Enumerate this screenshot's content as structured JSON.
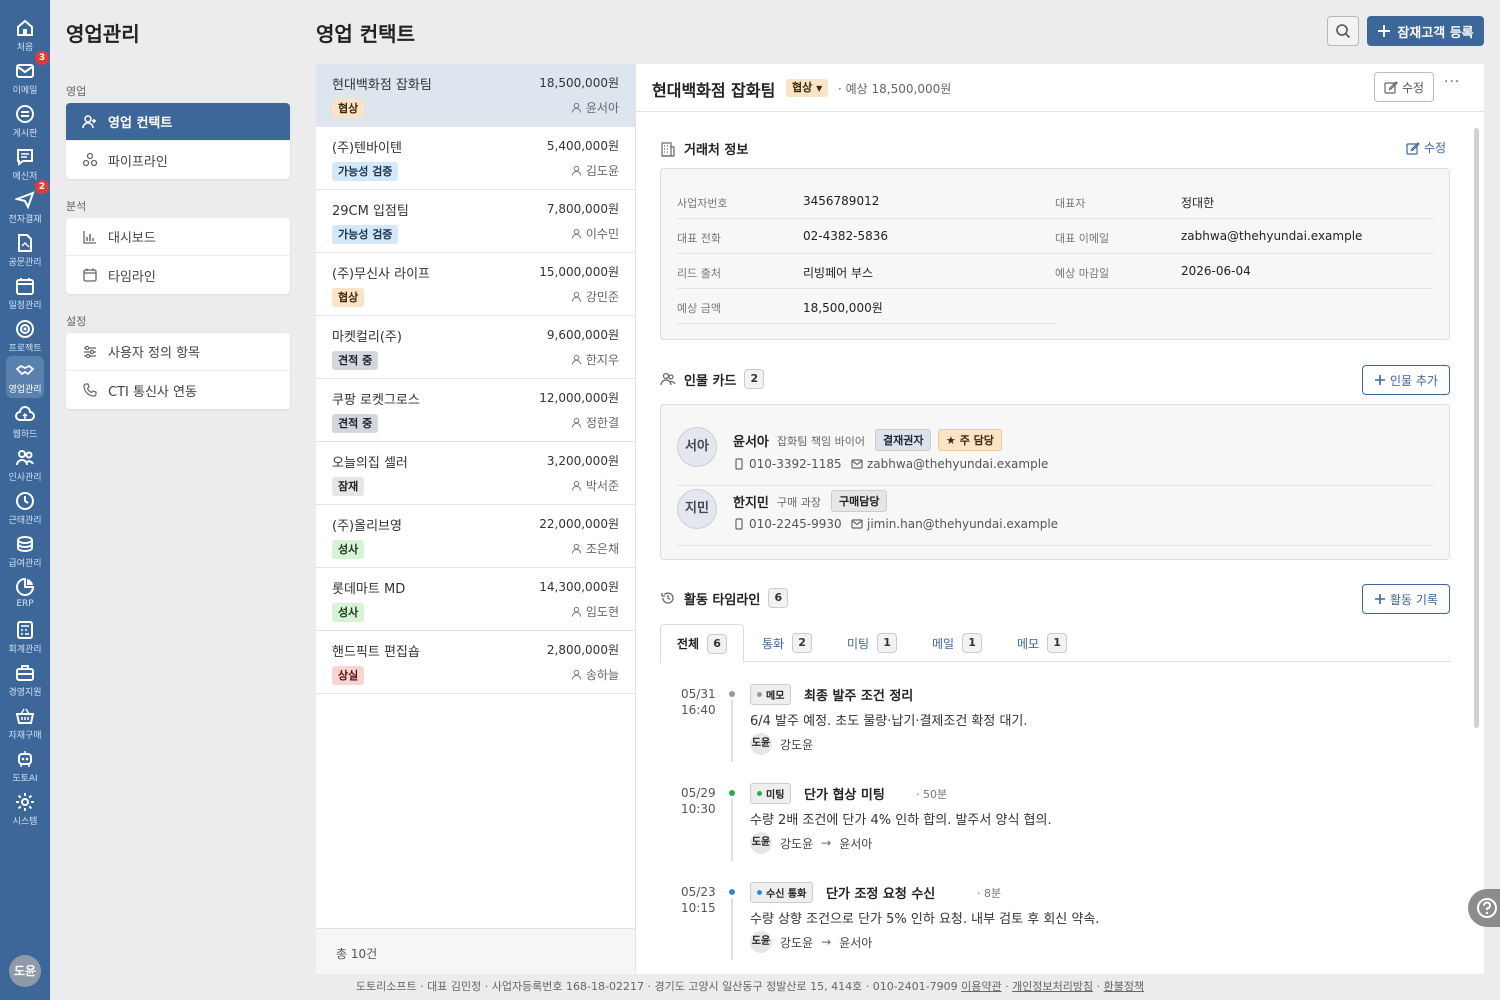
{
  "rail": {
    "items": [
      {
        "label": "처음",
        "icon": "home-icon"
      },
      {
        "label": "이메일",
        "icon": "mail-icon",
        "badge": "3"
      },
      {
        "label": "게시판",
        "icon": "board-icon"
      },
      {
        "label": "메신저",
        "icon": "messenger-icon"
      },
      {
        "label": "전자결재",
        "icon": "approval-icon",
        "badge": "2"
      },
      {
        "label": "공문관리",
        "icon": "document-icon"
      },
      {
        "label": "일정관리",
        "icon": "calendar-icon"
      },
      {
        "label": "프로젝트",
        "icon": "target-icon"
      },
      {
        "label": "영업관리",
        "icon": "handshake-icon",
        "active": true
      },
      {
        "label": "웹하드",
        "icon": "cloud-icon"
      },
      {
        "label": "인사관리",
        "icon": "people-icon"
      },
      {
        "label": "근태관리",
        "icon": "clock-icon"
      },
      {
        "label": "급여관리",
        "icon": "coins-icon"
      },
      {
        "label": "ERP",
        "icon": "pie-chart-icon"
      },
      {
        "label": "회계관리",
        "icon": "calculator-icon"
      },
      {
        "label": "경영지원",
        "icon": "briefcase-icon"
      },
      {
        "label": "자재구매",
        "icon": "basket-icon"
      },
      {
        "label": "도토AI",
        "icon": "robot-icon"
      },
      {
        "label": "시스템",
        "icon": "gear-icon"
      }
    ],
    "user_initials": "도윤"
  },
  "sidebar": {
    "title": "영업관리",
    "groups": [
      {
        "label": "영업",
        "items": [
          "영업 컨택트",
          "파이프라인"
        ]
      },
      {
        "label": "분석",
        "items": [
          "대시보드",
          "타임라인"
        ]
      },
      {
        "label": "설정",
        "items": [
          "사용자 정의 항목",
          "CTI 통신사 연동"
        ]
      }
    ]
  },
  "header": {
    "title": "영업 컨택트",
    "register_label": "잠재고객 등록"
  },
  "list": {
    "items": [
      {
        "name": "현대백화점 잡화팀",
        "amount": "18,500,000원",
        "stage": "협상",
        "owner": "윤서아"
      },
      {
        "name": "(주)텐바이텐",
        "amount": "5,400,000원",
        "stage": "가능성 검증",
        "owner": "김도윤"
      },
      {
        "name": "29CM 입점팀",
        "amount": "7,800,000원",
        "stage": "가능성 검증",
        "owner": "이수민"
      },
      {
        "name": "(주)무신사 라이프",
        "amount": "15,000,000원",
        "stage": "협상",
        "owner": "강민준"
      },
      {
        "name": "마켓컬리(주)",
        "amount": "9,600,000원",
        "stage": "견적 중",
        "owner": "한지우"
      },
      {
        "name": "쿠팡 로켓그로스",
        "amount": "12,000,000원",
        "stage": "견적 중",
        "owner": "정한결"
      },
      {
        "name": "오늘의집 셀러",
        "amount": "3,200,000원",
        "stage": "잠재",
        "owner": "박서준"
      },
      {
        "name": "(주)올리브영",
        "amount": "22,000,000원",
        "stage": "성사",
        "owner": "조은채"
      },
      {
        "name": "롯데마트 MD",
        "amount": "14,300,000원",
        "stage": "성사",
        "owner": "임도현"
      },
      {
        "name": "핸드픽트 편집숍",
        "amount": "2,800,000원",
        "stage": "상실",
        "owner": "송하늘"
      }
    ],
    "total": "총 10건"
  },
  "detail": {
    "title": "현대백화점 잡화팀",
    "stage": "협상",
    "expected": "· 예상 18,500,000원",
    "edit_label": "수정",
    "more": "···",
    "company": {
      "heading": "거래처 정보",
      "edit_label": "수정",
      "fields": {
        "biz_no_label": "사업자번호",
        "biz_no": "3456789012",
        "ceo_label": "대표자",
        "ceo": "정대한",
        "phone_label": "대표 전화",
        "phone": "02-4382-5836",
        "email_label": "대표 이메일",
        "email": "zabhwa@thehyundai.example",
        "source_label": "리드 출처",
        "source": "리빙페어 부스",
        "close_label": "예상 마감일",
        "close": "2026-06-04",
        "amount_label": "예상 금액",
        "amount": "18,500,000원"
      }
    },
    "people": {
      "heading": "인물 카드",
      "count": "2",
      "add_label": "인물 추가",
      "items": [
        {
          "initials": "서아",
          "name": "윤서아",
          "role": "잡화팀 책임 바이어",
          "tag": "결재권자",
          "primary": "주 담당",
          "phone": "010-3392-1185",
          "email": "zabhwa@thehyundai.example"
        },
        {
          "initials": "지민",
          "name": "한지민",
          "role": "구매 과장",
          "tag": "구매담당",
          "phone": "010-2245-9930",
          "email": "jimin.han@thehyundai.example"
        }
      ]
    },
    "timeline": {
      "heading": "활동 타임라인",
      "count": "6",
      "add_label": "활동 기록",
      "tabs": [
        {
          "label": "전체",
          "count": "6"
        },
        {
          "label": "통화",
          "count": "2"
        },
        {
          "label": "미팅",
          "count": "1"
        },
        {
          "label": "메일",
          "count": "1"
        },
        {
          "label": "메모",
          "count": "1"
        }
      ],
      "events": [
        {
          "date": "05/31",
          "time": "16:40",
          "type": "메모",
          "title": "최종 발주 조건 정리",
          "duration": "",
          "body": "6/4 발주 예정. 초도 물량·납기·결제조건 확정 대기.",
          "who_initials": "도윤",
          "who": "강도윤",
          "to": "",
          "dot_color": "#9a9a9a"
        },
        {
          "date": "05/29",
          "time": "10:30",
          "type": "미팅",
          "title": "단가 협상 미팅",
          "duration": "· 50분",
          "body": "수량 2배 조건에 단가 4% 인하 합의. 발주서 양식 협의.",
          "who_initials": "도윤",
          "who": "강도윤",
          "to": "윤서아",
          "dot_color": "#2fa84f"
        },
        {
          "date": "05/23",
          "time": "10:15",
          "type": "수신 통화",
          "title": "단가 조정 요청 수신",
          "duration": "· 8분",
          "body": "수량 상향 조건으로 단가 5% 인하 요청. 내부 검토 후 회신 약속.",
          "who_initials": "도윤",
          "who": "강도윤",
          "to": "윤서아",
          "dot_color": "#2f8ae6"
        }
      ]
    }
  },
  "footer": {
    "text": "도토리소프트 · 대표 김민정 · 사업자등록번호 168-18-02217 · 경기도 고양시 일산동구 정발산로 15, 414호 · 010-2401-7909",
    "links": [
      "이용약관",
      "개인정보처리방침",
      "환불정책"
    ]
  },
  "colors": {
    "accent": "#3d6798",
    "rail": "#3d6798",
    "alert": "#e23a3a"
  }
}
